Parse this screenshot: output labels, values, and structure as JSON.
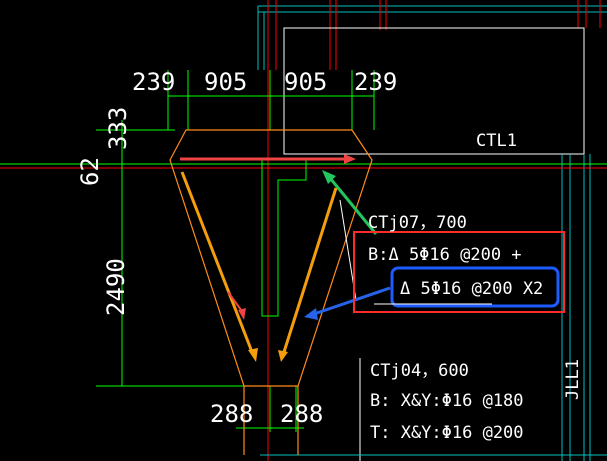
{
  "dimensions": {
    "top": [
      "239",
      "905",
      "905",
      "239"
    ],
    "left_small_top": "333",
    "left_small_bottom": "62",
    "left_long": "2490",
    "bottom": [
      "288",
      "288"
    ]
  },
  "labels": {
    "ctl1": "CTL1",
    "jll1": "JLL1",
    "ctj07": "CTj07，700",
    "b_line1": "B:Δ 5Φ16 @200 +",
    "b_line2": "Δ 5Φ16 @200 X2",
    "ctj04": "CTj04，600",
    "ctj04_b": "B:  X&Y:Φ16 @180",
    "ctj04_t": "T:  X&Y:Φ16 @200"
  },
  "colors": {
    "background": "#000000",
    "green": "#00ff00",
    "red": "#ff0000",
    "orange": "#ff8c1a",
    "white": "#ffffff",
    "cyan": "#00c0c0",
    "highlight_red": "#ff2a2a",
    "highlight_blue": "#1e5bff",
    "arrow_green": "#22c55e",
    "arrow_blue": "#2563eb",
    "arrow_orange": "#f59e0b",
    "arrow_red": "#ef4444"
  }
}
